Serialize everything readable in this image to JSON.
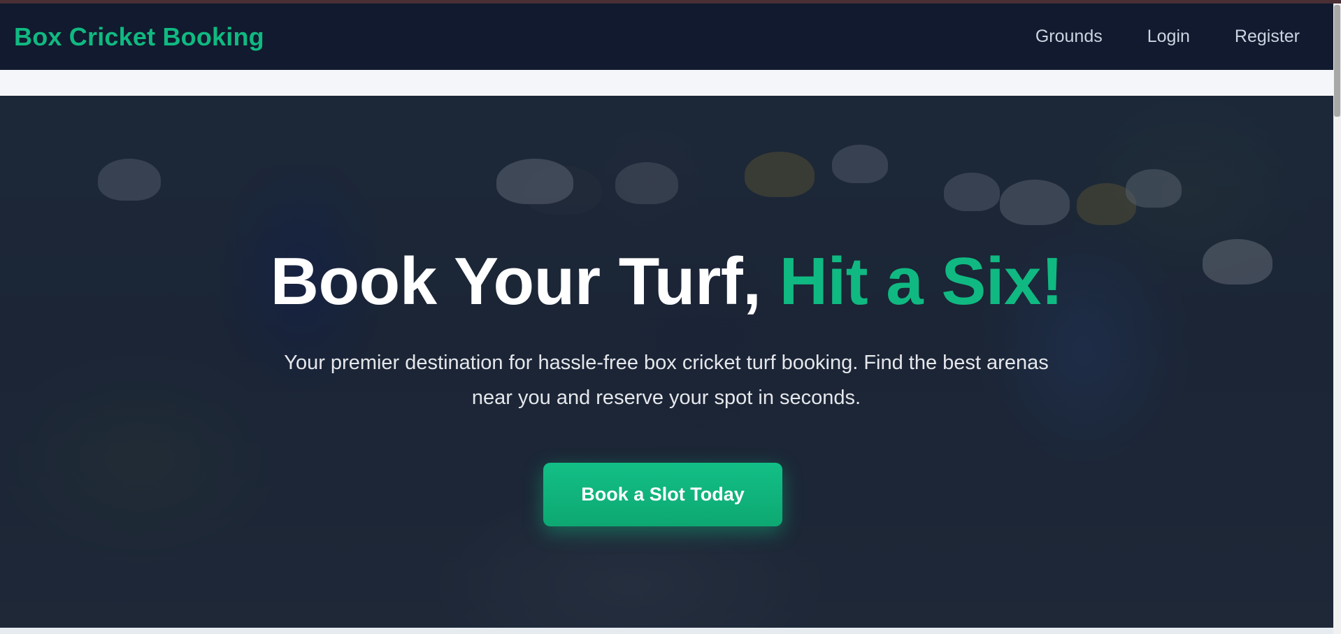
{
  "navbar": {
    "brand": "Box Cricket Booking",
    "links": [
      "Grounds",
      "Login",
      "Register"
    ]
  },
  "hero": {
    "title_main": "Book Your Turf, ",
    "title_accent": "Hit a Six!",
    "subtitle": "Your premier destination for hassle-free box cricket turf booking. Find the best arenas near you and reserve your spot in seconds.",
    "cta_label": "Book a Slot Today"
  },
  "colors": {
    "accent": "#10b981",
    "navbar_bg": "#111a2e",
    "nav_text": "#cbd5e1"
  }
}
